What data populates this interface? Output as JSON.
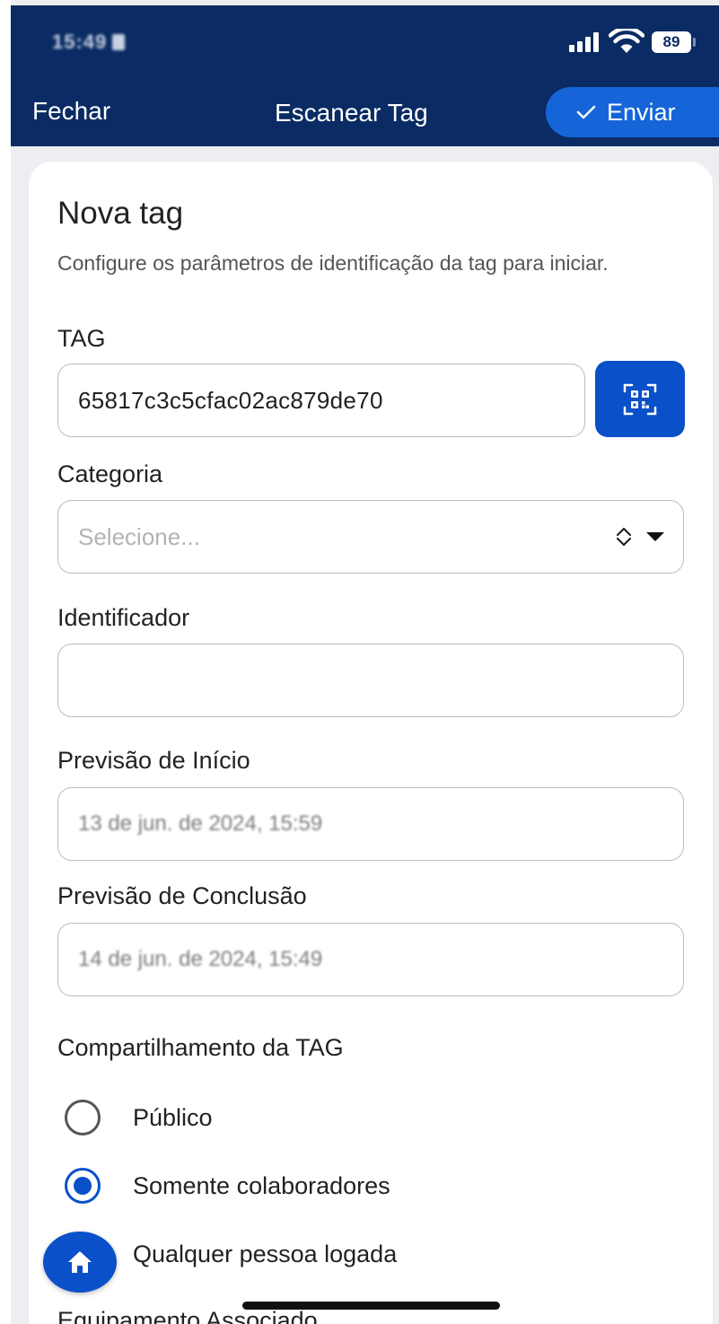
{
  "status_bar": {
    "time": "15:49",
    "battery": "89"
  },
  "nav": {
    "close_label": "Fechar",
    "title": "Escanear Tag",
    "send_label": "Enviar"
  },
  "form": {
    "title": "Nova tag",
    "subtitle": "Configure os parâmetros de identificação da tag para iniciar.",
    "tag": {
      "label": "TAG",
      "value": "65817c3c5cfac02ac879de70",
      "scan_icon": "qr-scan-icon"
    },
    "category": {
      "label": "Categoria",
      "placeholder": "Selecione..."
    },
    "identifier": {
      "label": "Identificador",
      "value": ""
    },
    "start": {
      "label": "Previsão de Início",
      "value": "13 de jun. de 2024, 15:59"
    },
    "end": {
      "label": "Previsão de Conclusão",
      "value": "14 de jun. de 2024, 15:49"
    },
    "sharing": {
      "label": "Compartilhamento da TAG",
      "options": [
        {
          "label": "Público",
          "selected": false
        },
        {
          "label": "Somente colaboradores",
          "selected": true
        },
        {
          "label": "Qualquer pessoa logada",
          "selected": false
        }
      ]
    },
    "next_section_label": "Equipamento Associado"
  },
  "colors": {
    "header": "#0a2b63",
    "accent": "#1565d8",
    "primary": "#0a50c8"
  },
  "icons": {
    "home": "home-icon",
    "check": "check-icon"
  }
}
